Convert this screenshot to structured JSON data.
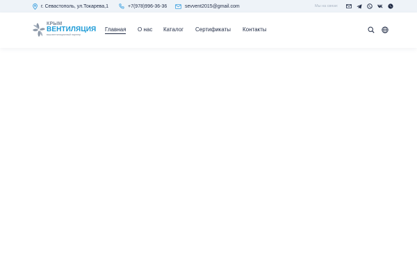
{
  "topbar": {
    "address": "г. Севастополь, ул.Токарева,1",
    "phone": "+7(978)996-36-36",
    "email": "sevvent2015@gmail.com",
    "social_label": "Мы на связи:",
    "socials": [
      "email-icon",
      "telegram-icon",
      "viber-icon",
      "vk-icon",
      "whatsapp-icon"
    ]
  },
  "logo": {
    "line1": "КРЫМ",
    "line2": "ВЕНТИЛЯЦИЯ",
    "line3": "ваш вентиляционный партнер"
  },
  "nav": {
    "items": [
      {
        "label": "Главная",
        "active": true
      },
      {
        "label": "О нас",
        "active": false
      },
      {
        "label": "Каталог",
        "active": false
      },
      {
        "label": "Сертификаты",
        "active": false
      },
      {
        "label": "Контакты",
        "active": false
      }
    ]
  },
  "header_icons": [
    "search-icon",
    "globe-icon"
  ],
  "colors": {
    "accent": "#1b9ad6",
    "topbar_bg": "#eef3f8",
    "text": "#1f2a44",
    "icon_blue": "#3aa0e0"
  }
}
